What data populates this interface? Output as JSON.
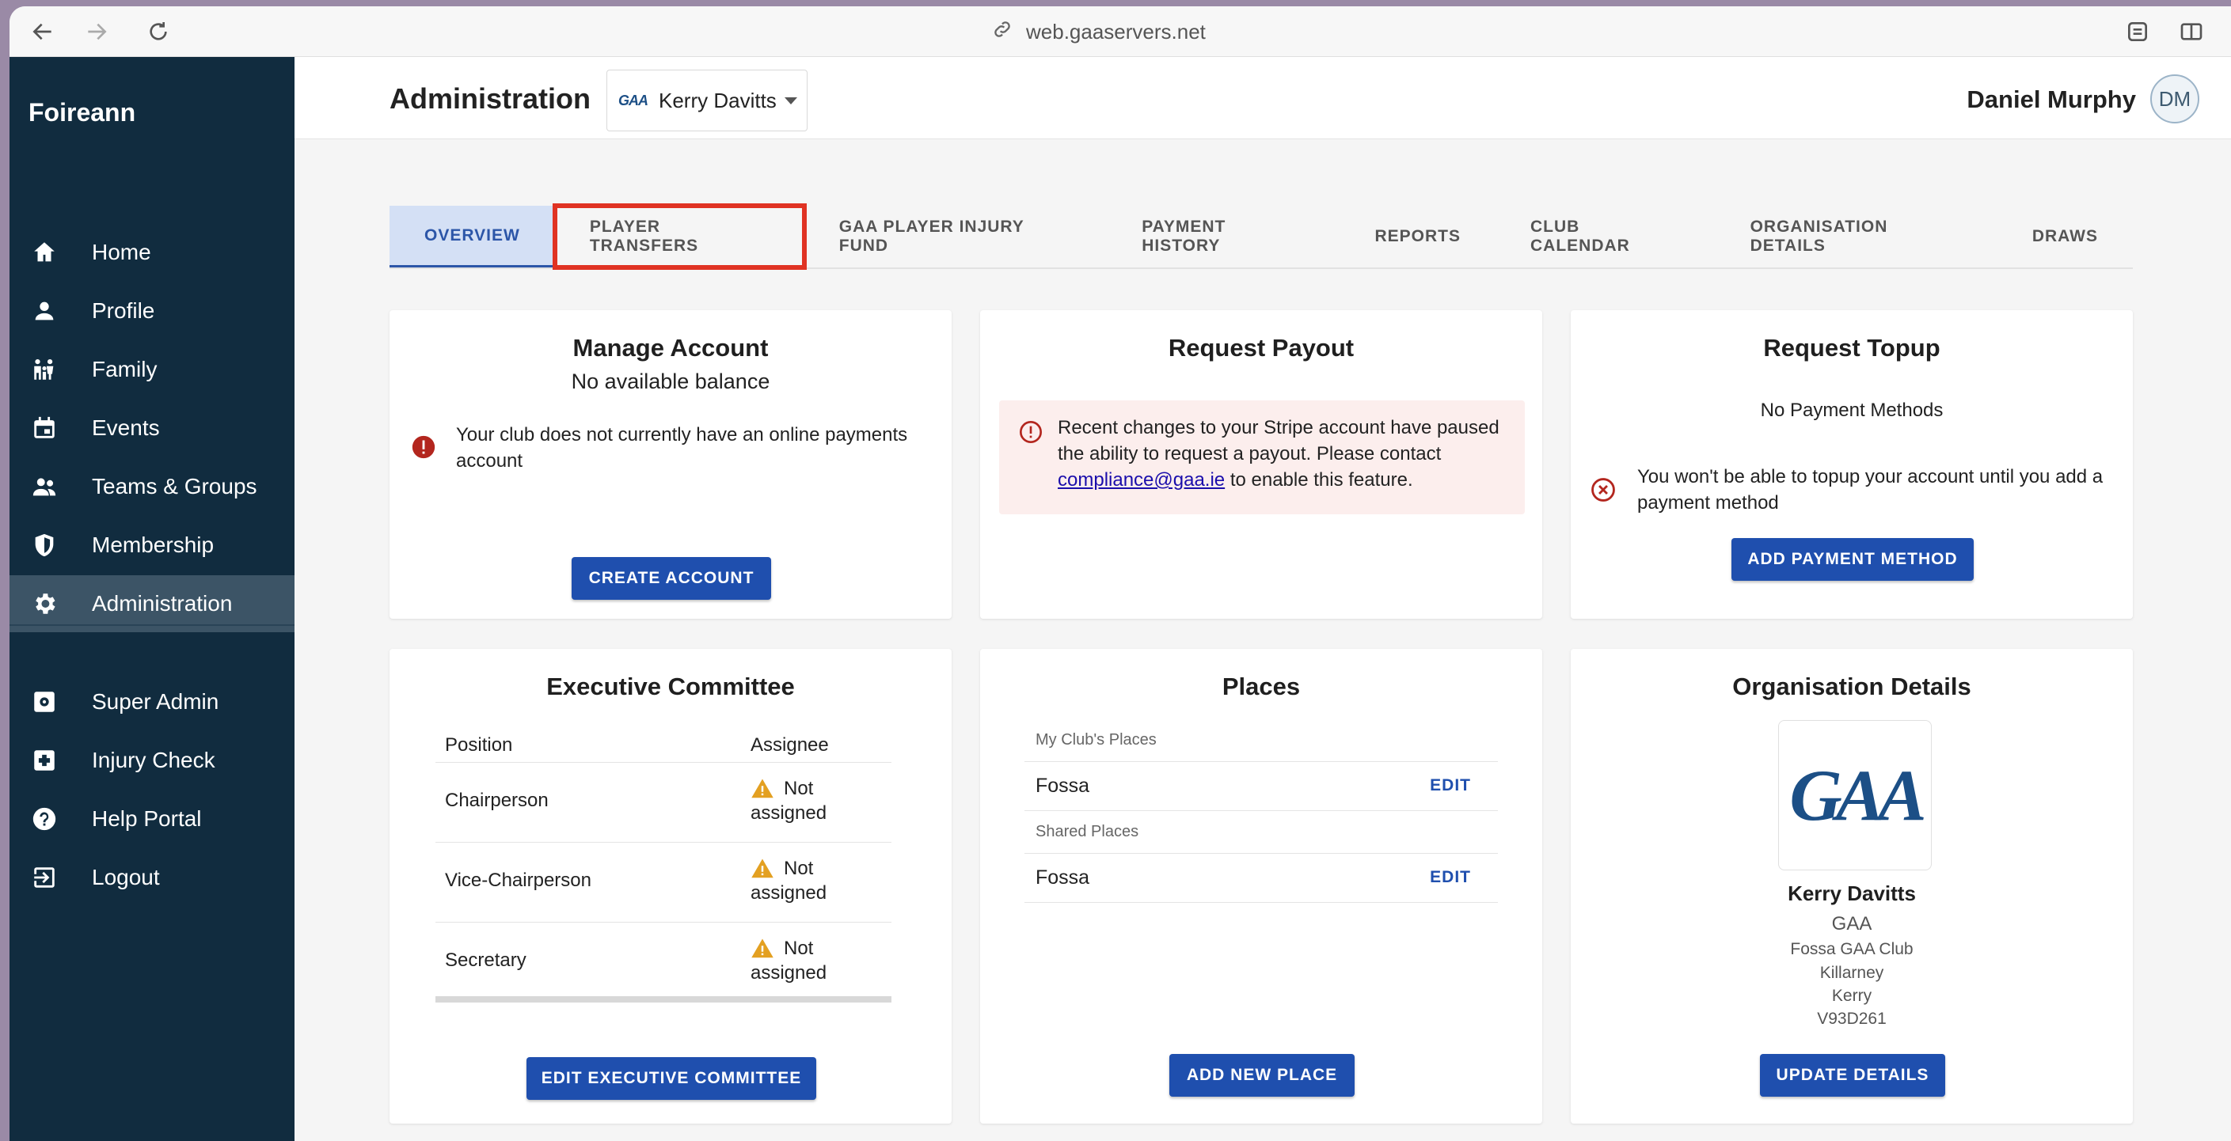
{
  "browser": {
    "url": "web.gaaservers.net"
  },
  "sidebar": {
    "brand": "Foireann",
    "items": [
      {
        "label": "Home",
        "icon": "home-icon"
      },
      {
        "label": "Profile",
        "icon": "person-icon"
      },
      {
        "label": "Family",
        "icon": "family-icon"
      },
      {
        "label": "Events",
        "icon": "calendar-icon"
      },
      {
        "label": "Teams & Groups",
        "icon": "group-icon"
      },
      {
        "label": "Membership",
        "icon": "shield-icon"
      },
      {
        "label": "Administration",
        "icon": "gear-icon",
        "active": true
      },
      {
        "label": "Super Admin",
        "icon": "admin-gear-icon"
      },
      {
        "label": "Injury Check",
        "icon": "medical-plus-icon"
      },
      {
        "label": "Help Portal",
        "icon": "help-icon"
      },
      {
        "label": "Logout",
        "icon": "logout-icon"
      }
    ]
  },
  "header": {
    "title": "Administration",
    "org_select": {
      "logo_text": "GAA",
      "value": "Kerry Davitts"
    },
    "user_name": "Daniel Murphy",
    "avatar_initials": "DM"
  },
  "tabs": [
    {
      "label": "OVERVIEW",
      "active": true
    },
    {
      "label": "PLAYER TRANSFERS",
      "highlighted": true
    },
    {
      "label": "GAA PLAYER INJURY FUND"
    },
    {
      "label": "PAYMENT HISTORY"
    },
    {
      "label": "REPORTS"
    },
    {
      "label": "CLUB CALENDAR"
    },
    {
      "label": "ORGANISATION DETAILS"
    },
    {
      "label": "DRAWS"
    }
  ],
  "manage_account": {
    "title": "Manage Account",
    "balance": "No available balance",
    "message": "Your club does not currently have an online payments account",
    "button": "CREATE ACCOUNT"
  },
  "request_payout": {
    "title": "Request Payout",
    "alert_pre": "Recent changes to your Stripe account have paused the ability to request a payout. Please contact ",
    "alert_link": "compliance@gaa.ie",
    "alert_post": " to enable this feature."
  },
  "request_topup": {
    "title": "Request Topup",
    "status": "No Payment Methods",
    "message": "You won't be able to topup your account until you add a payment method",
    "button": "ADD PAYMENT METHOD"
  },
  "executive_committee": {
    "title": "Executive Committee",
    "columns": [
      "Position",
      "Assignee"
    ],
    "rows": [
      {
        "position": "Chairperson",
        "assignee_1": "Not",
        "assignee_2": "assigned"
      },
      {
        "position": "Vice-Chairperson",
        "assignee_1": "Not",
        "assignee_2": "assigned"
      },
      {
        "position": "Secretary",
        "assignee_1": "Not",
        "assignee_2": "assigned"
      }
    ],
    "button": "EDIT EXECUTIVE COMMITTEE"
  },
  "places": {
    "title": "Places",
    "my_label": "My Club's Places",
    "my_place": "Fossa",
    "shared_label": "Shared Places",
    "shared_place": "Fossa",
    "edit": "EDIT",
    "button": "ADD NEW PLACE"
  },
  "organisation_details": {
    "title": "Organisation Details",
    "logo_text": "GAA",
    "name": "Kerry Davitts",
    "body": "GAA",
    "club": "Fossa GAA Club",
    "town": "Killarney",
    "county": "Kerry",
    "eircode": "V93D261",
    "button": "UPDATE DETAILS"
  },
  "colors": {
    "sidebar_bg": "#112c3f",
    "sidebar_active": "#3c5466",
    "primary": "#1f4fae",
    "highlight_outline": "#e03323",
    "warning": "#e3a021",
    "error": "#b3261e"
  }
}
